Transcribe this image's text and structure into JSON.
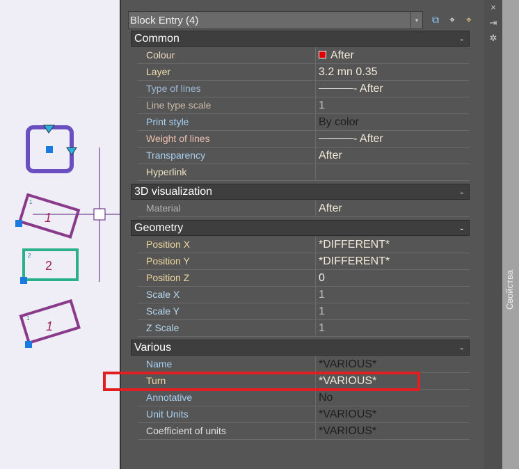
{
  "combo": {
    "title": "Block Entry (4)"
  },
  "toolbar": [
    {
      "icon": "quick-select-icon",
      "glyph": "⧉"
    },
    {
      "icon": "select-objects-icon",
      "glyph": "⌖"
    },
    {
      "icon": "toggle-pickadd-icon",
      "glyph": "⌖"
    }
  ],
  "side": {
    "close": "×",
    "autohide": "⇥",
    "settings": "✲",
    "title": "Свойства"
  },
  "sections": {
    "common": {
      "title": "Common",
      "toggle": "-",
      "rows": [
        {
          "label": "Colour",
          "value": "After",
          "color": "#e8d8c0"
        },
        {
          "label": "Layer",
          "value": "3.2 mn 0.35",
          "color": "#f0e0b0"
        },
        {
          "label": "Type of lines",
          "value": "- After",
          "color": "#9fb8d8"
        },
        {
          "label": "Line type scale",
          "value": "1",
          "color": "#c8b8a8"
        },
        {
          "label": "Print style",
          "value": "By color",
          "color": "#a8d0f0"
        },
        {
          "label": "Weight of lines",
          "value": "- After",
          "color": "#f0c0b0"
        },
        {
          "label": "Transparency",
          "value": "After",
          "color": "#a8d0f0"
        },
        {
          "label": "Hyperlink",
          "value": "",
          "color": "#e8e0c0"
        }
      ]
    },
    "vis": {
      "title": "3D visualization",
      "toggle": "-",
      "rows": [
        {
          "label": "Material",
          "value": "After",
          "color": "#b0b0b0"
        }
      ]
    },
    "geom": {
      "title": "Geometry",
      "toggle": "-",
      "rows": [
        {
          "label": "Position X",
          "value": "*DIFFERENT*",
          "color": "#f0d8a0"
        },
        {
          "label": "Position Y",
          "value": "*DIFFERENT*",
          "color": "#f0d8a0"
        },
        {
          "label": "Position Z",
          "value": "0",
          "color": "#f0d8a0"
        },
        {
          "label": "Scale X",
          "value": "1",
          "color": "#b8d8f0"
        },
        {
          "label": "Scale Y",
          "value": "1",
          "color": "#b8d8f0"
        },
        {
          "label": "Z Scale",
          "value": "1",
          "color": "#b8d8f0"
        }
      ]
    },
    "various": {
      "title": "Various",
      "toggle": "-",
      "rows": [
        {
          "label": "Name",
          "value": "*VARIOUS*",
          "color": "#a8d0f0"
        },
        {
          "label": "Turn",
          "value": "*VARIOUS*",
          "color": "#f0d8a0"
        },
        {
          "label": "Annotative",
          "value": "No",
          "color": "#a8d0f0"
        },
        {
          "label": "Unit Units",
          "value": "*VARIOUS*",
          "color": "#a8d0f0"
        },
        {
          "label": "Coefficient of units",
          "value": "*VARIOUS*",
          "color": "#e0e0e0"
        }
      ]
    }
  },
  "drawing": {
    "labels": [
      "1",
      "1",
      "2",
      "2",
      "1",
      "1"
    ]
  }
}
